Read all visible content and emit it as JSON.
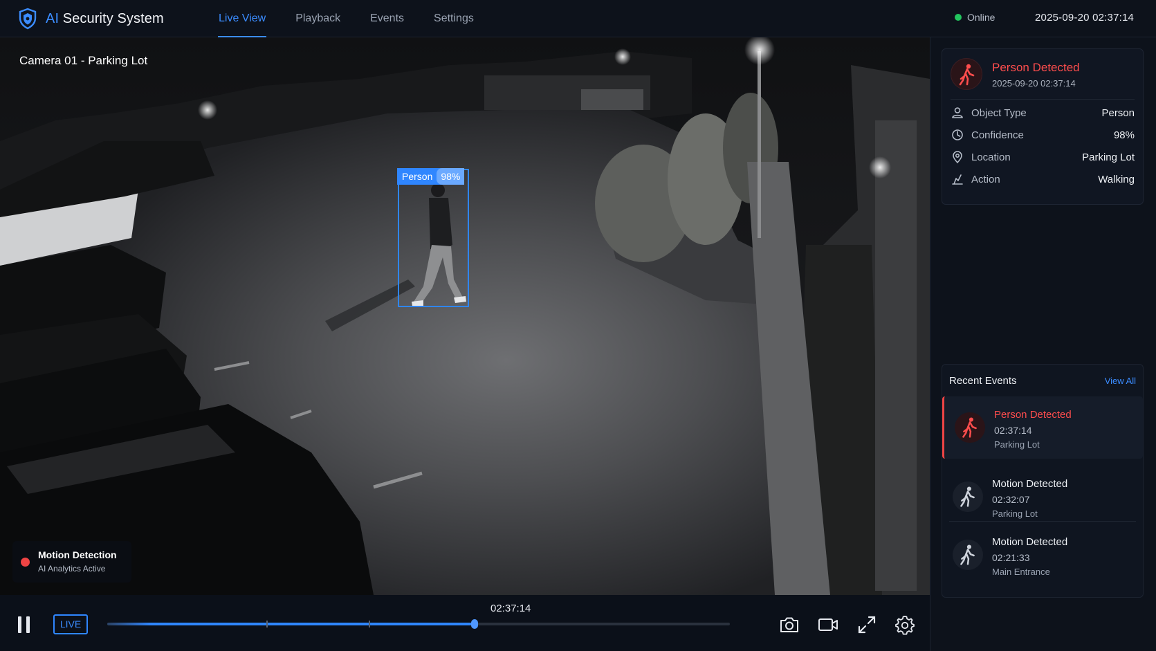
{
  "app": {
    "title_prefix": "AI",
    "title_rest": " Security System",
    "logo_icon": "shield-icon"
  },
  "nav": {
    "tabs": [
      {
        "label": "Live View",
        "active": true
      },
      {
        "label": "Playback",
        "active": false
      },
      {
        "label": "Events",
        "active": false
      },
      {
        "label": "Settings",
        "active": false
      }
    ]
  },
  "status": {
    "label": "Online",
    "color": "#22c55e"
  },
  "clock": "2025-09-20 02:37:14",
  "video": {
    "camera_label": "Camera 01 - Parking Lot",
    "detection": {
      "label": "Person",
      "confidence": "98%"
    },
    "motion": {
      "title": "Motion Detection",
      "subtitle": "AI Analytics Active"
    }
  },
  "controls": {
    "live_label": "LIVE",
    "current_time": "02:37:14",
    "progress_fraction": 0.59,
    "icons": [
      "pause-icon",
      "camera-snapshot-icon",
      "record-video-icon",
      "fullscreen-icon",
      "settings-gear-icon"
    ]
  },
  "detection_card": {
    "title": "Person Detected",
    "timestamp": "2025-09-20 02:37:14",
    "rows": [
      {
        "icon": "user-icon",
        "label": "Object Type",
        "value": "Person"
      },
      {
        "icon": "confidence-icon",
        "label": "Confidence",
        "value": "98%"
      },
      {
        "icon": "location-pin-icon",
        "label": "Location",
        "value": "Parking Lot"
      },
      {
        "icon": "action-icon",
        "label": "Action",
        "value": "Walking"
      }
    ]
  },
  "recent_events": {
    "title": "Recent Events",
    "view_all": "View All",
    "items": [
      {
        "title": "Person Detected",
        "time": "02:37:14",
        "location": "Parking Lot",
        "active": true
      },
      {
        "title": "Motion Detected",
        "time": "02:32:07",
        "location": "Parking Lot",
        "active": false
      },
      {
        "title": "Motion Detected",
        "time": "02:21:33",
        "location": "Main Entrance",
        "active": false
      }
    ]
  },
  "colors": {
    "accent": "#2f86ff",
    "alert": "#ef4444",
    "online": "#22c55e"
  }
}
